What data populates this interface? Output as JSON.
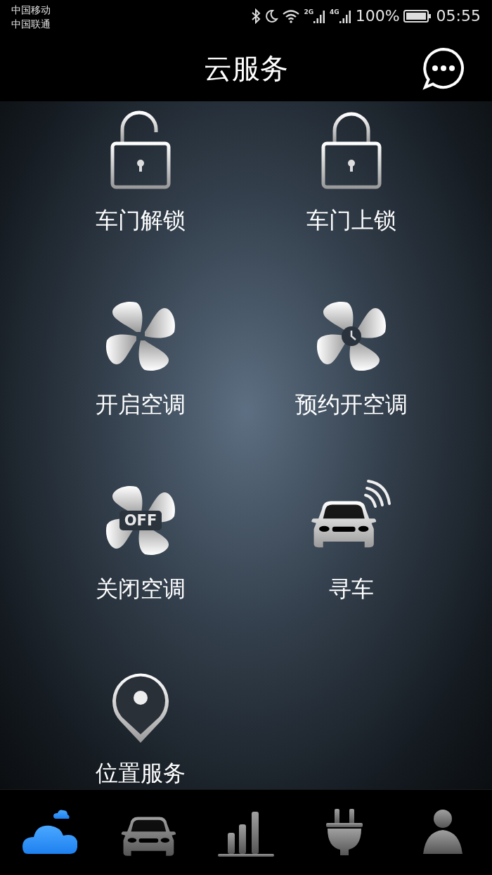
{
  "status_bar": {
    "carriers": [
      "中国移动",
      "中国联通"
    ],
    "networks": [
      {
        "label": "2G"
      },
      {
        "label": "4G"
      }
    ],
    "battery": "100%",
    "time": "05:55"
  },
  "header": {
    "title": "云服务"
  },
  "services": [
    {
      "kind": "unlock",
      "label": "车门解锁"
    },
    {
      "kind": "lock",
      "label": "车门上锁"
    },
    {
      "kind": "fan",
      "label": "开启空调"
    },
    {
      "kind": "fan-timer",
      "label": "预约开空调"
    },
    {
      "kind": "fan-off",
      "label": "关闭空调",
      "badge": "OFF"
    },
    {
      "kind": "car-signal",
      "label": "寻车"
    },
    {
      "kind": "location",
      "label": "位置服务"
    }
  ],
  "bottom_nav": [
    {
      "kind": "cloud",
      "selected": true
    },
    {
      "kind": "car",
      "selected": false
    },
    {
      "kind": "chart",
      "selected": false
    },
    {
      "kind": "plug",
      "selected": false
    },
    {
      "kind": "person",
      "selected": false
    }
  ]
}
